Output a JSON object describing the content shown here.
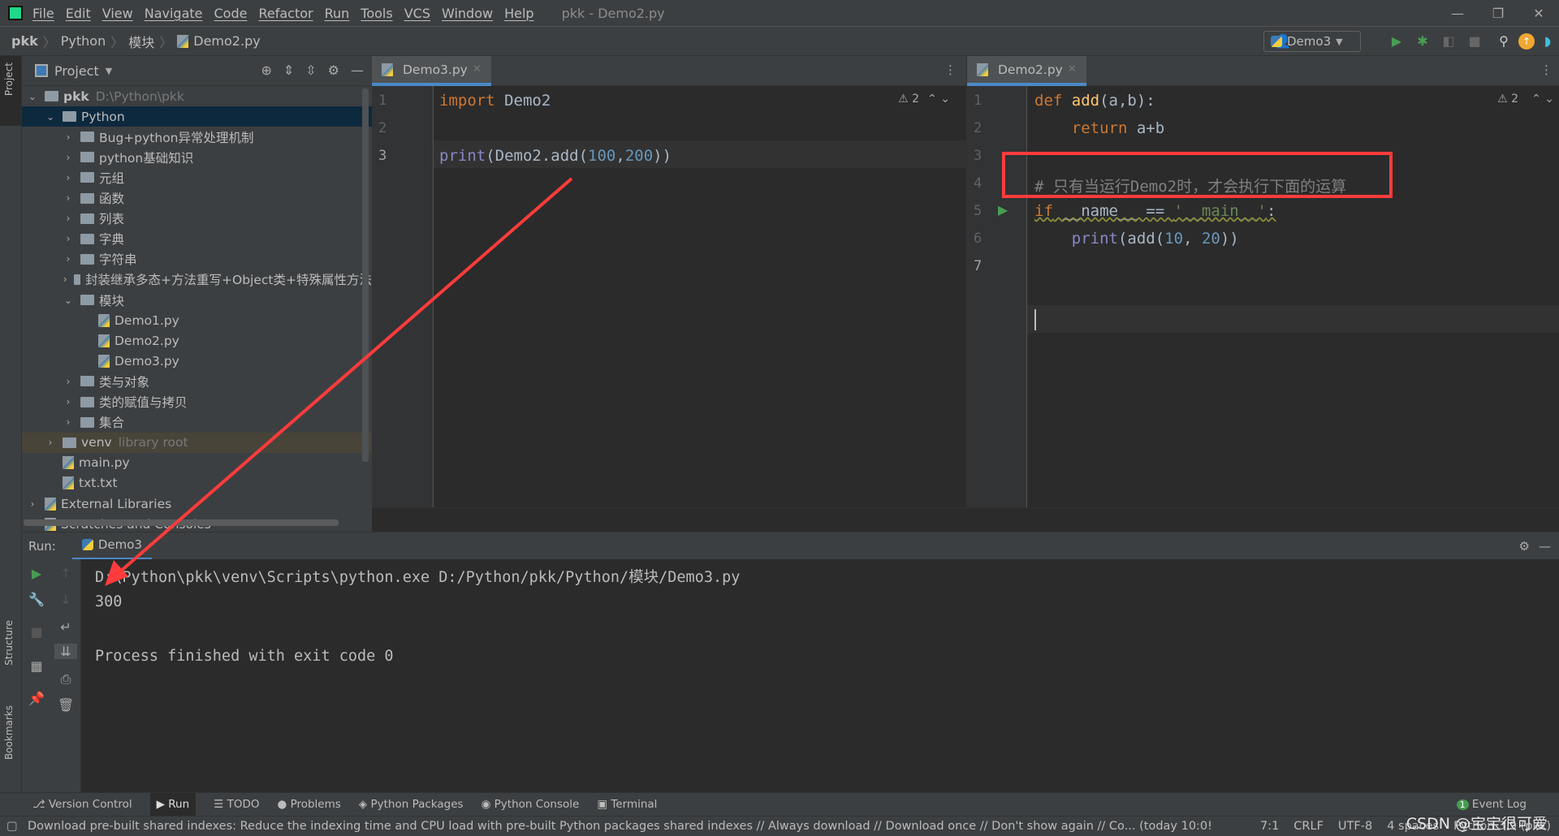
{
  "menubar": {
    "items": [
      "File",
      "Edit",
      "View",
      "Navigate",
      "Code",
      "Refactor",
      "Run",
      "Tools",
      "VCS",
      "Window",
      "Help"
    ],
    "title": "pkk - Demo2.py"
  },
  "breadcrumb": [
    "pkk",
    "Python",
    "模块",
    "Demo2.py"
  ],
  "toolbar": {
    "run_config": "Demo3"
  },
  "left_stripe": {
    "project": "Project",
    "structure": "Structure",
    "bookmarks": "Bookmarks"
  },
  "project": {
    "title": "Project",
    "tree": [
      {
        "label": "pkk",
        "extra": "D:\\Python\\pkk",
        "type": "folder",
        "depth": 0,
        "state": "open"
      },
      {
        "label": "Python",
        "type": "folder",
        "depth": 1,
        "state": "open",
        "selected": true
      },
      {
        "label": "Bug+python异常处理机制",
        "type": "folder",
        "depth": 2,
        "state": "closed"
      },
      {
        "label": "python基础知识",
        "type": "folder",
        "depth": 2,
        "state": "closed"
      },
      {
        "label": "元组",
        "type": "folder",
        "depth": 2,
        "state": "closed"
      },
      {
        "label": "函数",
        "type": "folder",
        "depth": 2,
        "state": "closed"
      },
      {
        "label": "列表",
        "type": "folder",
        "depth": 2,
        "state": "closed"
      },
      {
        "label": "字典",
        "type": "folder",
        "depth": 2,
        "state": "closed"
      },
      {
        "label": "字符串",
        "type": "folder",
        "depth": 2,
        "state": "closed"
      },
      {
        "label": "封装继承多态+方法重写+Object类+特殊属性方法",
        "type": "folder",
        "depth": 2,
        "state": "closed"
      },
      {
        "label": "模块",
        "type": "folder",
        "depth": 2,
        "state": "open"
      },
      {
        "label": "Demo1.py",
        "type": "py",
        "depth": 3
      },
      {
        "label": "Demo2.py",
        "type": "py",
        "depth": 3
      },
      {
        "label": "Demo3.py",
        "type": "py",
        "depth": 3
      },
      {
        "label": "类与对象",
        "type": "folder",
        "depth": 2,
        "state": "closed"
      },
      {
        "label": "类的赋值与拷贝",
        "type": "folder",
        "depth": 2,
        "state": "closed"
      },
      {
        "label": "集合",
        "type": "folder",
        "depth": 2,
        "state": "closed"
      },
      {
        "label": "venv",
        "extra": "library root",
        "type": "folder",
        "depth": 1,
        "state": "closed",
        "venv": true
      },
      {
        "label": "main.py",
        "type": "py",
        "depth": 1
      },
      {
        "label": "txt.txt",
        "type": "txt",
        "depth": 1
      },
      {
        "label": "External Libraries",
        "type": "lib",
        "depth": 0,
        "state": "closed"
      },
      {
        "label": "Scratches and Consoles",
        "type": "scratch",
        "depth": 0
      }
    ]
  },
  "editor_left": {
    "tab": "Demo3.py",
    "warnings": "2",
    "lines": [
      "1",
      "2",
      "3"
    ]
  },
  "editor_right": {
    "tab": "Demo2.py",
    "warnings": "2",
    "lines": [
      "1",
      "2",
      "3",
      "4",
      "5",
      "6",
      "7"
    ],
    "comment": "# 只有当运行Demo2时，才会执行下面的运算"
  },
  "run": {
    "label": "Run:",
    "tab": "Demo3",
    "output": [
      "D:\\Python\\pkk\\venv\\Scripts\\python.exe D:/Python/pkk/Python/模块/Demo3.py",
      "300",
      "Process finished with exit code 0"
    ]
  },
  "bottom_tabs": [
    "Version Control",
    "Run",
    "TODO",
    "Problems",
    "Python Packages",
    "Python Console",
    "Terminal"
  ],
  "event_log": {
    "label": "Event Log",
    "count": "1"
  },
  "status": {
    "message": "Download pre-built shared indexes: Reduce the indexing time and CPU load with pre-built Python packages shared indexes // Always download // Download once // Don't show again // Co... (today 10:0!",
    "position": "7:1",
    "line_sep": "CRLF",
    "encoding": "UTF-8",
    "indent": "4 spaces",
    "interpreter": "Python 3.9 (pkk)"
  },
  "watermark": "CSDN @宝宝很可爱",
  "colors": {
    "annotation": "#ff3b3b",
    "accent": "#4a88c7"
  }
}
